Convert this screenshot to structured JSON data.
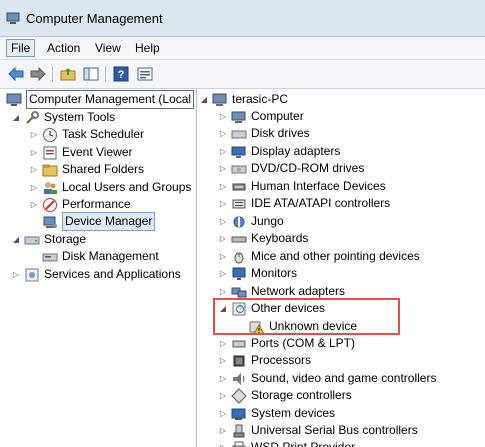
{
  "window": {
    "title": "Computer Management"
  },
  "menu": [
    {
      "label": "File",
      "active": true
    },
    {
      "label": "Action",
      "active": false
    },
    {
      "label": "View",
      "active": false
    },
    {
      "label": "Help",
      "active": false
    }
  ],
  "toolbar": {
    "buttons": [
      "back-icon",
      "forward-icon",
      "up-folder-icon",
      "show-hide-tree-icon",
      "help-icon",
      "properties-icon"
    ]
  },
  "left_tree": {
    "root": "Computer Management (Local",
    "items": [
      {
        "label": "System Tools",
        "icon": "tools-icon",
        "expanded": true
      },
      {
        "label": "Task Scheduler",
        "icon": "clock-icon"
      },
      {
        "label": "Event Viewer",
        "icon": "event-viewer-icon"
      },
      {
        "label": "Shared Folders",
        "icon": "shared-folder-icon"
      },
      {
        "label": "Local Users and Groups",
        "icon": "users-icon"
      },
      {
        "label": "Performance",
        "icon": "performance-icon"
      },
      {
        "label": "Device Manager",
        "icon": "device-manager-icon",
        "selected": true
      },
      {
        "label": "Storage",
        "icon": "storage-icon",
        "expanded": true
      },
      {
        "label": "Disk Management",
        "icon": "disk-icon"
      },
      {
        "label": "Services and Applications",
        "icon": "services-icon"
      }
    ]
  },
  "right_tree": {
    "root": "terasic-PC",
    "items": [
      {
        "label": "Computer",
        "icon": "computer-icon"
      },
      {
        "label": "Disk drives",
        "icon": "disk-drive-icon"
      },
      {
        "label": "Display adapters",
        "icon": "display-icon"
      },
      {
        "label": "DVD/CD-ROM drives",
        "icon": "dvd-icon"
      },
      {
        "label": "Human Interface Devices",
        "icon": "hid-icon"
      },
      {
        "label": "IDE ATA/ATAPI controllers",
        "icon": "ide-icon"
      },
      {
        "label": "Jungo",
        "icon": "jungo-icon"
      },
      {
        "label": "Keyboards",
        "icon": "keyboard-icon"
      },
      {
        "label": "Mice and other pointing devices",
        "icon": "mouse-icon"
      },
      {
        "label": "Monitors",
        "icon": "monitor-icon"
      },
      {
        "label": "Network adapters",
        "icon": "network-icon"
      },
      {
        "label": "Other devices",
        "icon": "other-devices-icon",
        "expanded": true
      },
      {
        "label": "Unknown device",
        "icon": "warning-icon",
        "child": true
      },
      {
        "label": "Ports (COM & LPT)",
        "icon": "port-icon"
      },
      {
        "label": "Processors",
        "icon": "processor-icon"
      },
      {
        "label": "Sound, video and game controllers",
        "icon": "sound-icon"
      },
      {
        "label": "Storage controllers",
        "icon": "storage-controller-icon"
      },
      {
        "label": "System devices",
        "icon": "system-devices-icon"
      },
      {
        "label": "Universal Serial Bus controllers",
        "icon": "usb-icon"
      },
      {
        "label": "WSD Print Provider",
        "icon": "printer-icon"
      }
    ]
  },
  "colors": {
    "highlight_box": "#d9534f",
    "selection": "#dfeaf7",
    "title_bar": "#dce6f1"
  }
}
